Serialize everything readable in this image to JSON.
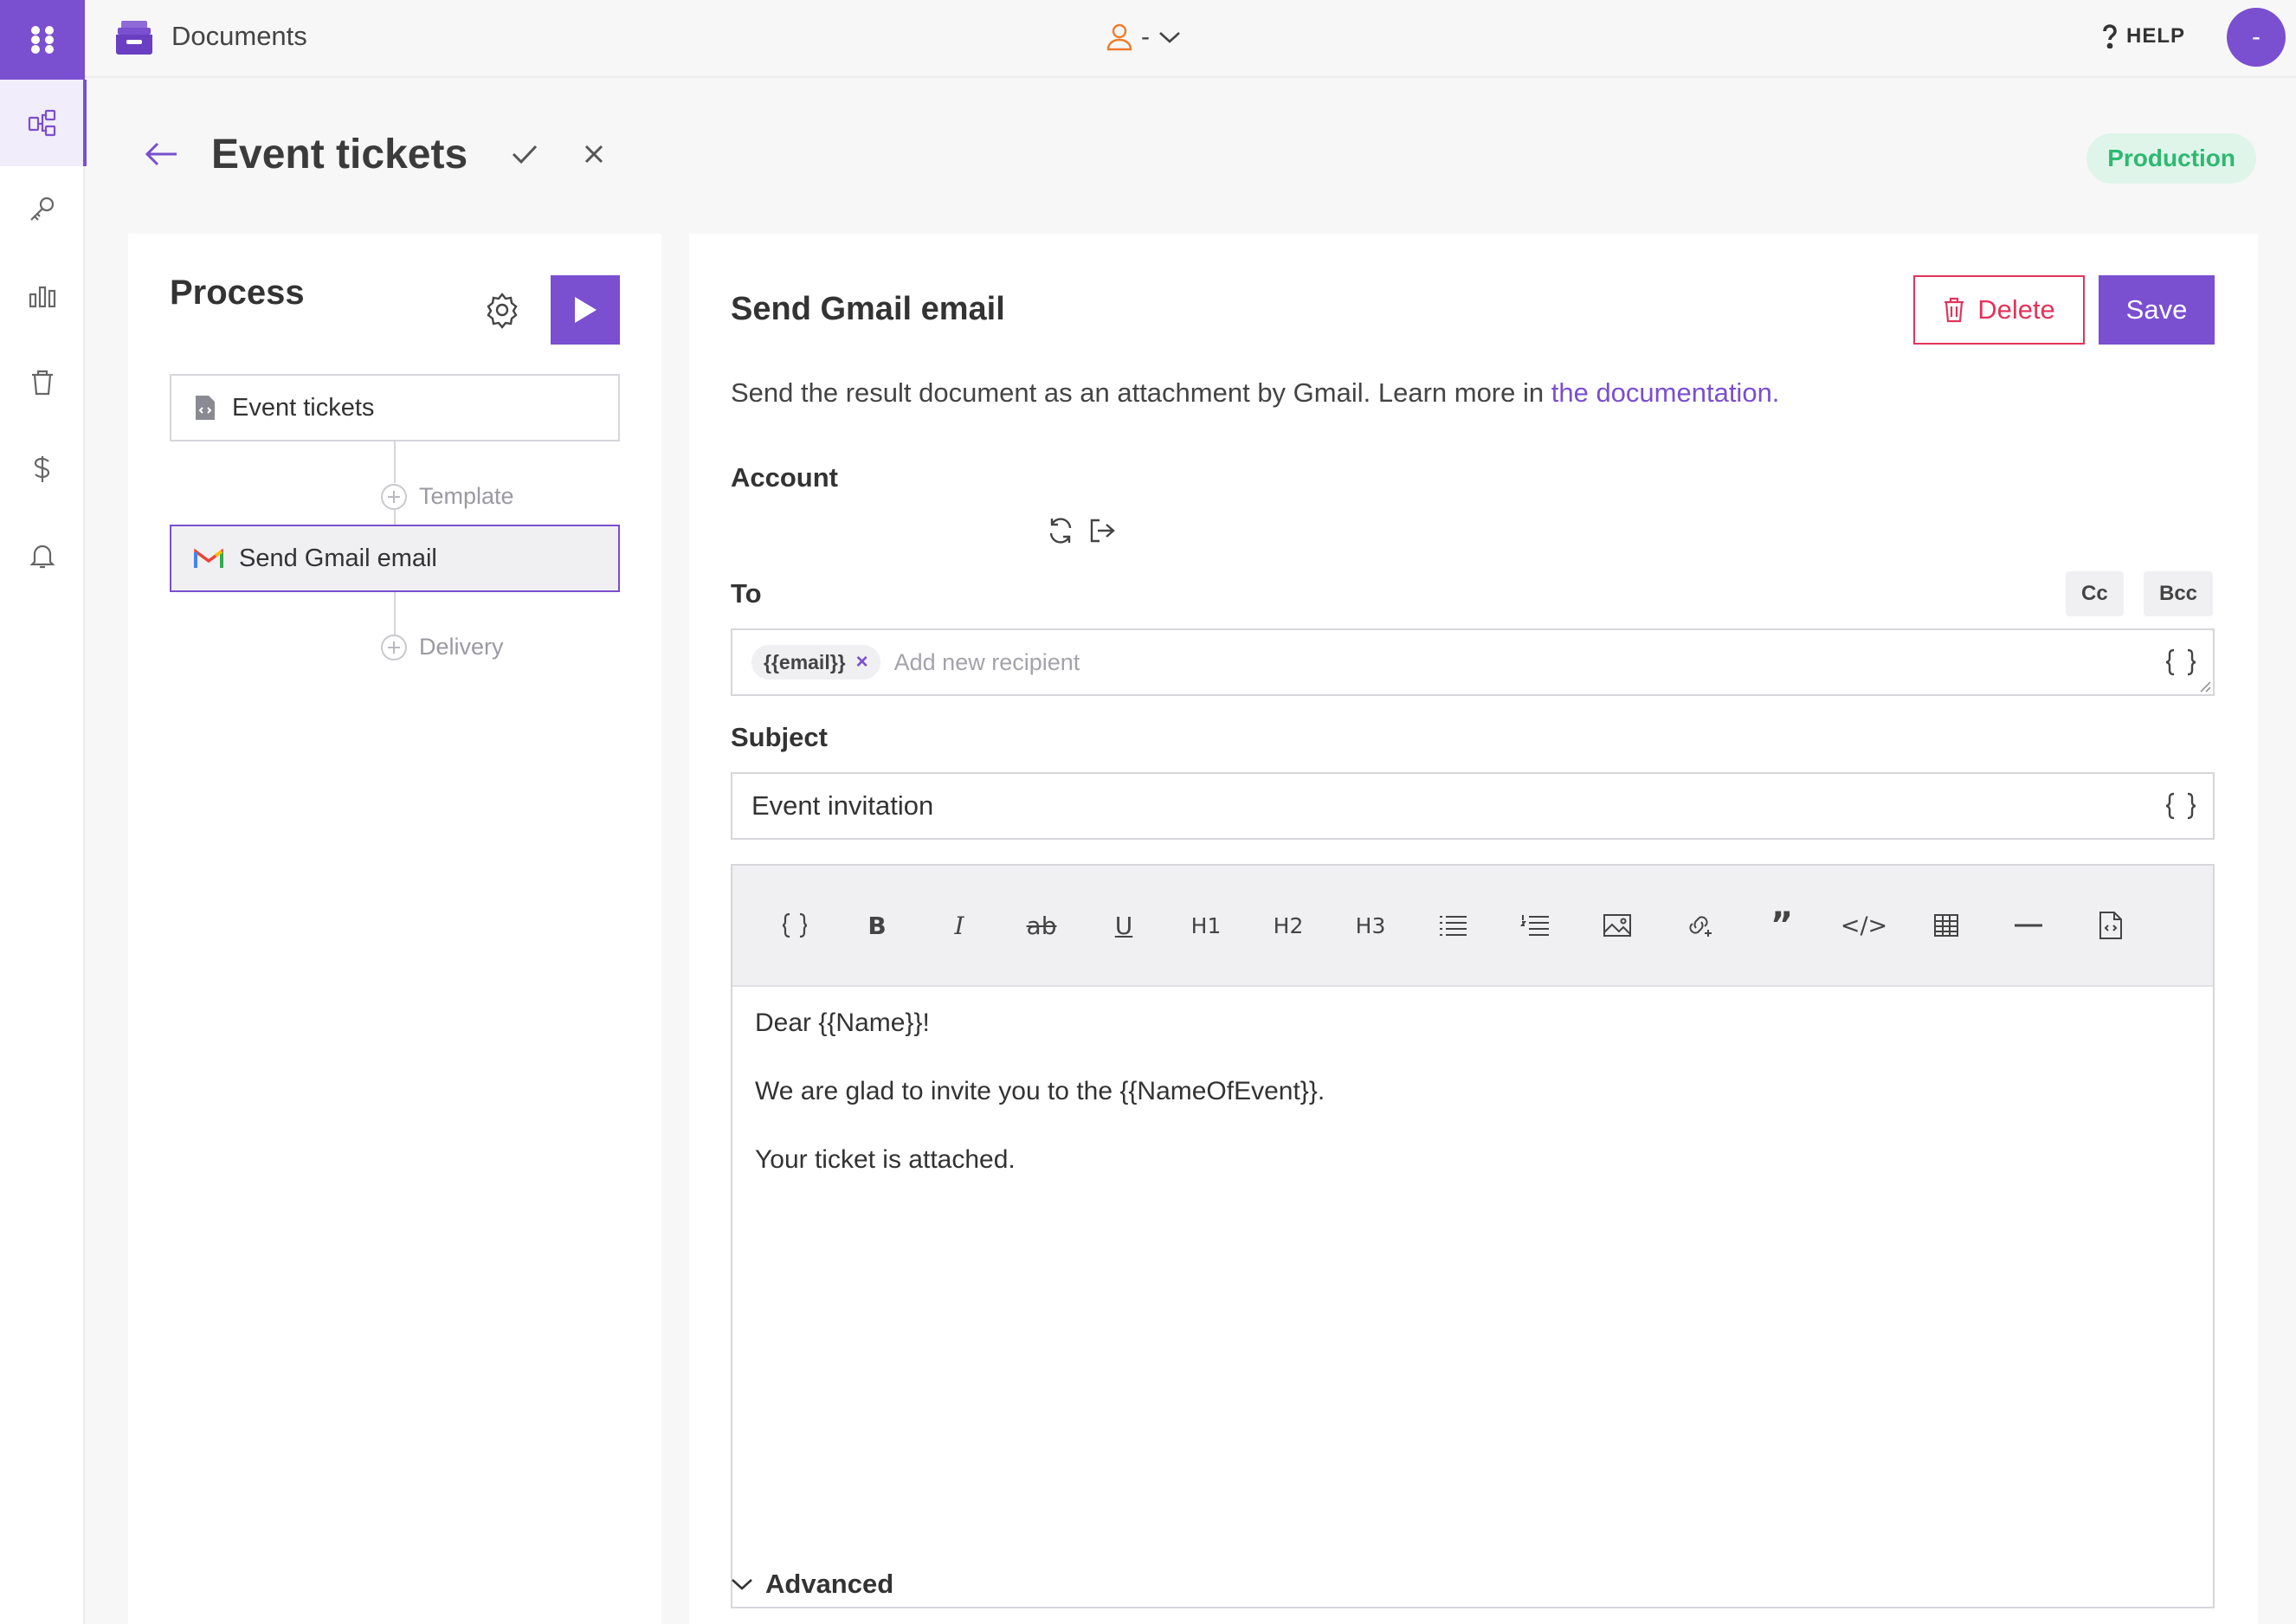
{
  "app": {
    "title": "Documents",
    "user": "-",
    "help": "HELP",
    "avatar_initial": "-"
  },
  "sidebar": {
    "items": [
      {
        "icon": "process-icon",
        "active": true
      },
      {
        "icon": "key-icon"
      },
      {
        "icon": "chart-icon"
      },
      {
        "icon": "trash-icon"
      },
      {
        "icon": "dollar-icon"
      },
      {
        "icon": "bell-icon"
      }
    ]
  },
  "header": {
    "title": "Event tickets",
    "environment": "Production"
  },
  "process": {
    "title": "Process",
    "nodes": [
      {
        "label": "Event tickets",
        "icon": "document-icon"
      },
      {
        "label": "Send Gmail email",
        "icon": "gmail-icon",
        "selected": true
      }
    ],
    "add_steps": [
      "Template",
      "Delivery"
    ]
  },
  "editor": {
    "title": "Send Gmail email",
    "delete_label": "Delete",
    "save_label": "Save",
    "description": "Send the result document as an attachment by Gmail. Learn more in ",
    "doc_link": "the documentation.",
    "account_label": "Account",
    "to_label": "To",
    "cc_label": "Cc",
    "bcc_label": "Bcc",
    "recipient_tag": "{{email}}",
    "recipient_placeholder": "Add new recipient",
    "subject_label": "Subject",
    "subject_value": "Event invitation",
    "toolbar": [
      "{ }",
      "B",
      "I",
      "ab",
      "U",
      "H1",
      "H2",
      "H3",
      "bullet-list-icon",
      "numbered-list-icon",
      "image-icon",
      "link-icon",
      "”",
      "</>",
      "table-icon",
      "hr-icon",
      "html-file-icon"
    ],
    "body": [
      "Dear {{Name}}!",
      "We are glad to invite you to the {{NameOfEvent}}.",
      "Your ticket is attached."
    ],
    "advanced_label": "Advanced"
  },
  "colors": {
    "accent": "#7a4fd0",
    "danger": "#e2345b",
    "success": "#2eb872"
  }
}
